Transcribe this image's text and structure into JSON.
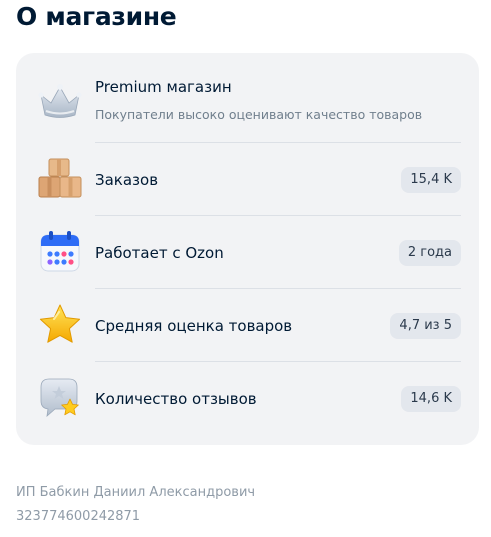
{
  "page": {
    "title": "О магазине"
  },
  "rows": [
    {
      "icon": "crown-icon",
      "label": "Premium магазин",
      "sub": "Покупатели высоко оценивают качество товаров"
    },
    {
      "icon": "boxes-icon",
      "label": "Заказов",
      "value": "15,4 K"
    },
    {
      "icon": "calendar-icon",
      "label": "Работает с Ozon",
      "value": "2 года"
    },
    {
      "icon": "star-icon",
      "label": "Средняя оценка товаров",
      "value": "4,7 из 5"
    },
    {
      "icon": "review-bubble-icon",
      "label": "Количество отзывов",
      "value": "14,6 K"
    }
  ],
  "seller": {
    "name": "ИП Бабкин Даниил Александрович",
    "ogrn": "323774600242871"
  },
  "colors": {
    "card_background": "#f2f3f5",
    "badge_background": "#e3e7ed",
    "text_primary": "#001a34",
    "text_secondary": "#707f8d"
  }
}
